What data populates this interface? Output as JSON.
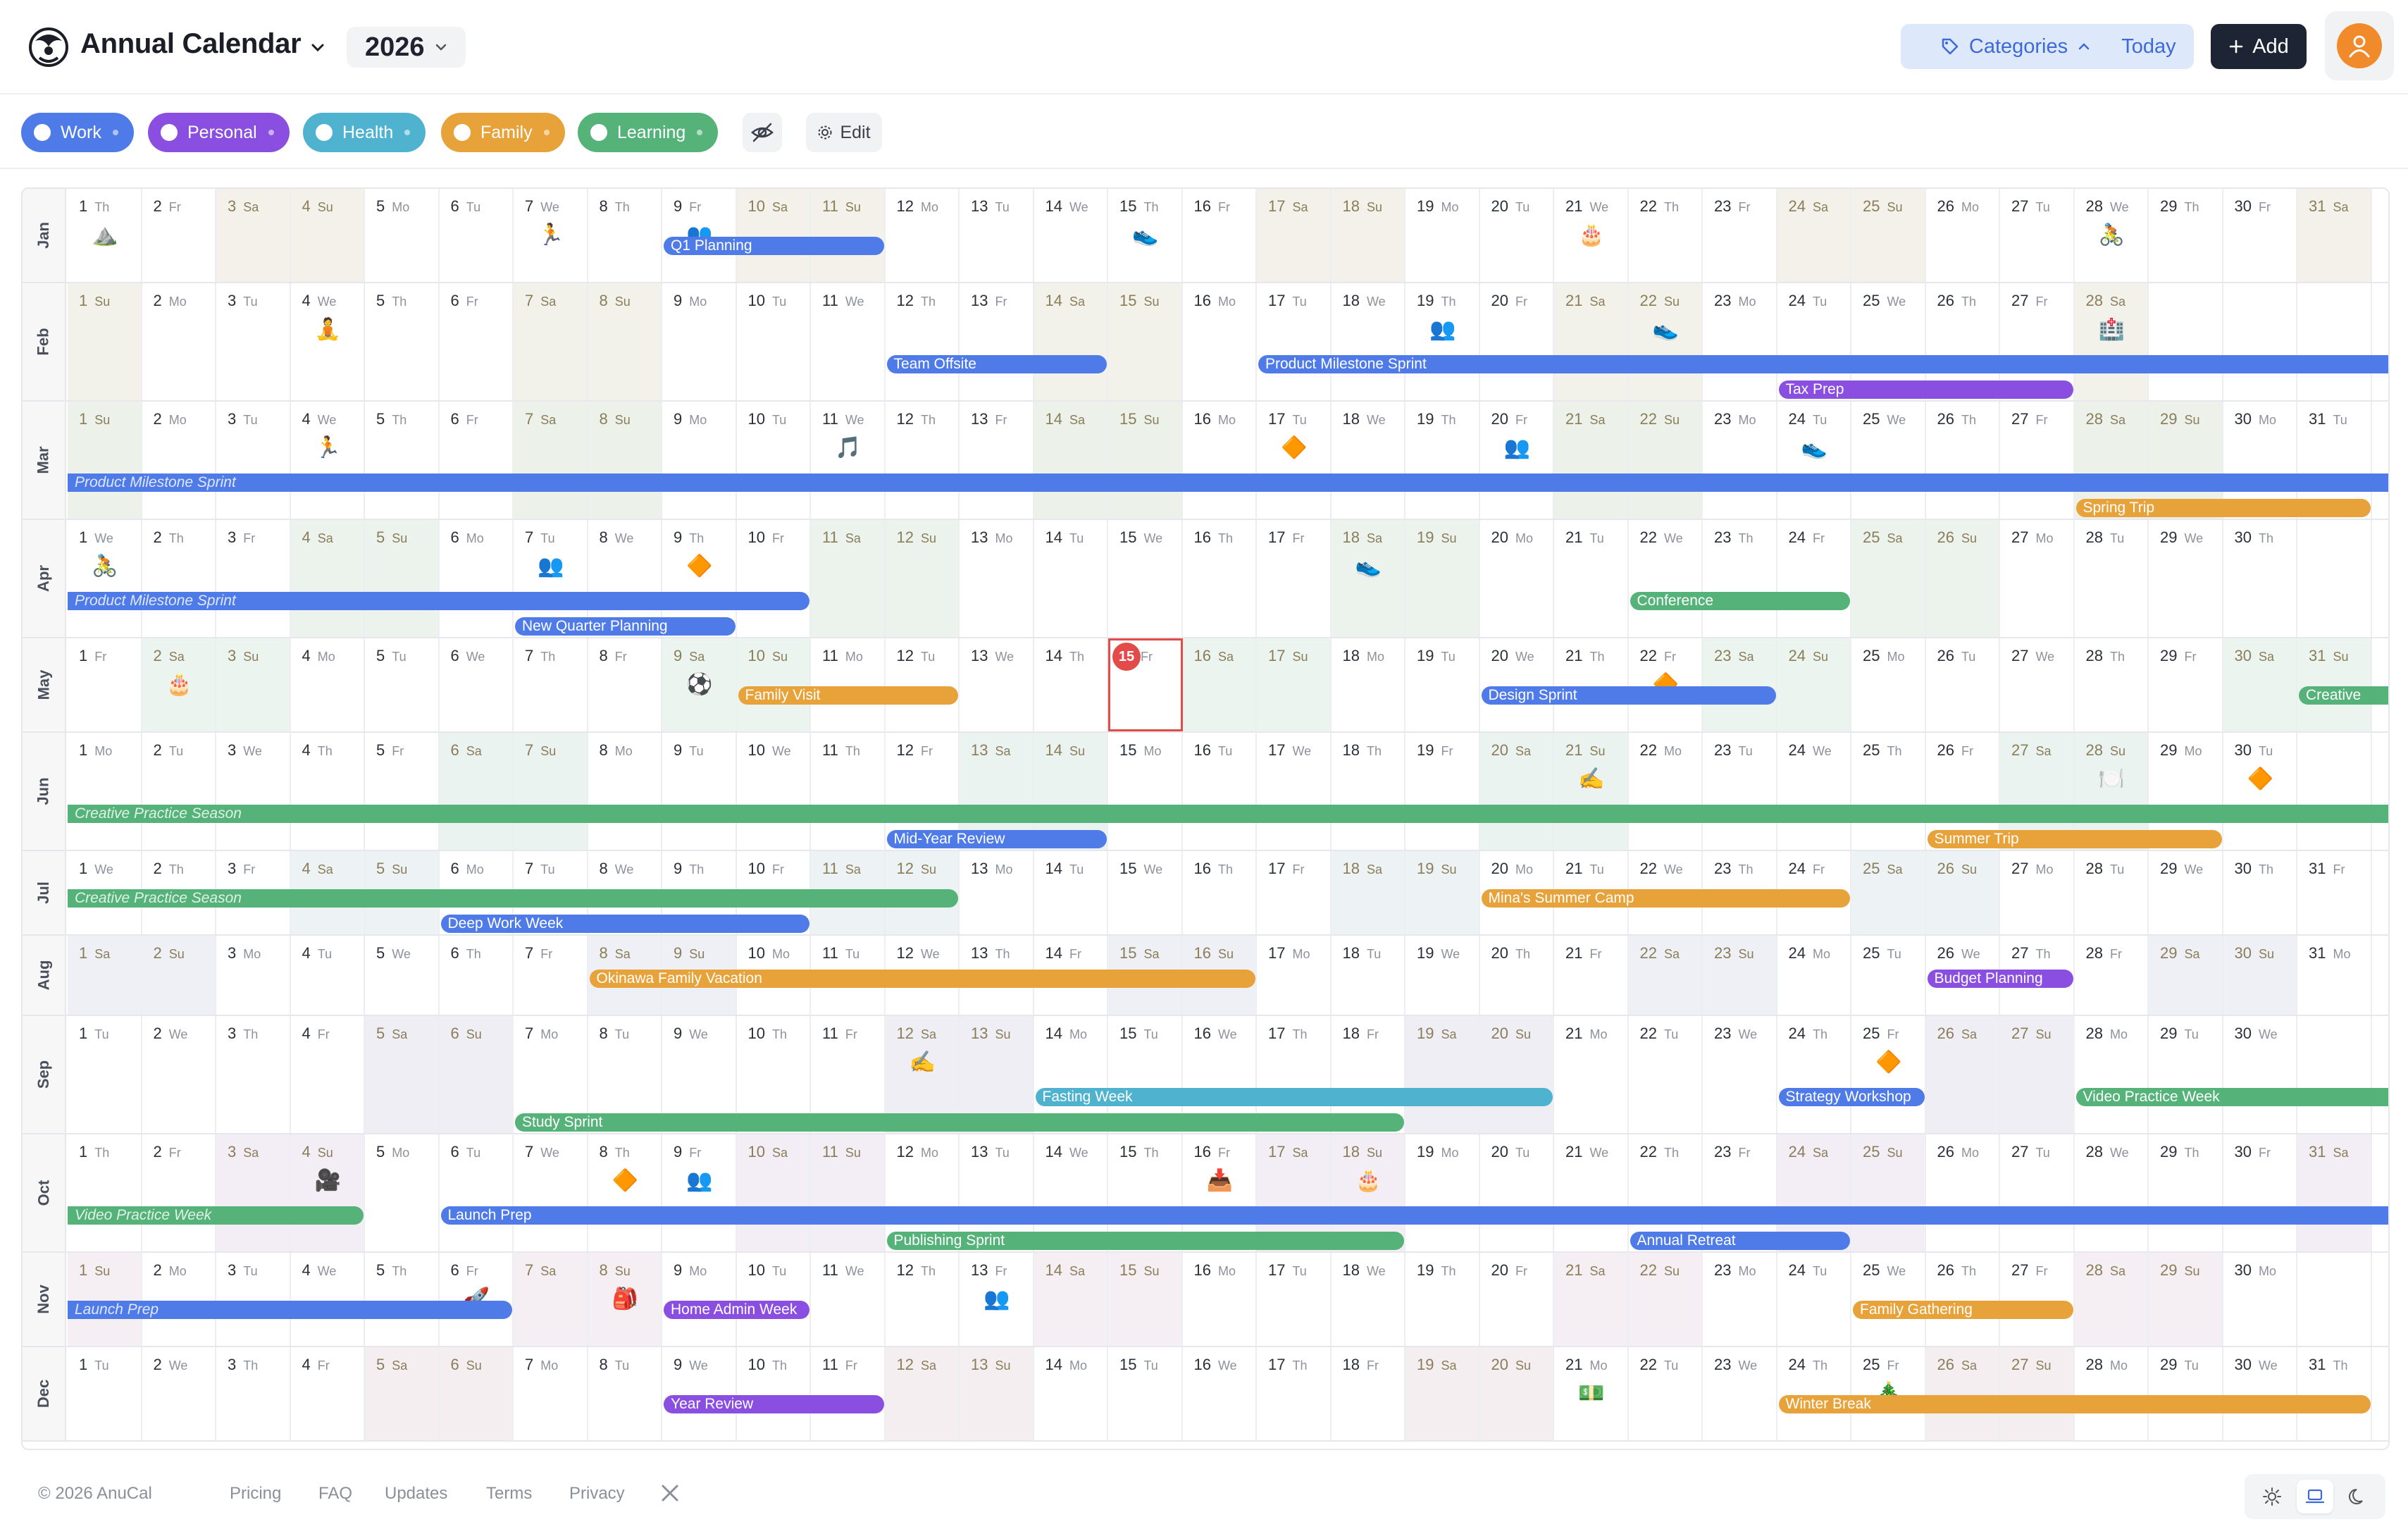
{
  "header": {
    "title": "Annual Calendar",
    "year": "2026",
    "categories_label": "Categories",
    "today_label": "Today",
    "add_label": "Add"
  },
  "filters": {
    "categories": [
      {
        "name": "Work",
        "color": "#4f7be8"
      },
      {
        "name": "Personal",
        "color": "#8a4fe0"
      },
      {
        "name": "Health",
        "color": "#4fb3d0"
      },
      {
        "name": "Family",
        "color": "#e8a23a"
      },
      {
        "name": "Learning",
        "color": "#55b37a"
      }
    ],
    "edit_label": "Edit"
  },
  "calendar": {
    "year": 2026,
    "today": {
      "month": 5,
      "day": 15
    },
    "months": [
      "Jan",
      "Feb",
      "Mar",
      "Apr",
      "May",
      "Jun",
      "Jul",
      "Aug",
      "Sep",
      "Oct",
      "Nov",
      "Dec"
    ],
    "weekdays": [
      "Su",
      "Mo",
      "Tu",
      "We",
      "Th",
      "Fr",
      "Sa"
    ],
    "month_shades": [
      "#f3f1ea",
      "#f2f2ea",
      "#ecf2ea",
      "#ebf3ec",
      "#ebf4ee",
      "#ebf3f1",
      "#edf2f4",
      "#eef0f5",
      "#f0eef5",
      "#f3eef5",
      "#f5eef3",
      "#f5eef1"
    ],
    "weekend_day_color": "#8a7d5a",
    "icons": [
      {
        "m": 1,
        "d": 1,
        "icon": "⛰️"
      },
      {
        "m": 1,
        "d": 7,
        "icon": "🏃"
      },
      {
        "m": 1,
        "d": 9,
        "icon": "👥"
      },
      {
        "m": 1,
        "d": 15,
        "icon": "👟"
      },
      {
        "m": 1,
        "d": 21,
        "icon": "🎂"
      },
      {
        "m": 1,
        "d": 28,
        "icon": "🚴"
      },
      {
        "m": 2,
        "d": 4,
        "icon": "🧘"
      },
      {
        "m": 2,
        "d": 19,
        "icon": "👥"
      },
      {
        "m": 2,
        "d": 22,
        "icon": "👟"
      },
      {
        "m": 2,
        "d": 28,
        "icon": "🏥"
      },
      {
        "m": 3,
        "d": 4,
        "icon": "🏃"
      },
      {
        "m": 3,
        "d": 11,
        "icon": "🎵"
      },
      {
        "m": 3,
        "d": 17,
        "icon": "🔶"
      },
      {
        "m": 3,
        "d": 20,
        "icon": "👥"
      },
      {
        "m": 3,
        "d": 24,
        "icon": "👟"
      },
      {
        "m": 4,
        "d": 1,
        "icon": "🚴"
      },
      {
        "m": 4,
        "d": 7,
        "icon": "👥"
      },
      {
        "m": 4,
        "d": 9,
        "icon": "🔶"
      },
      {
        "m": 4,
        "d": 18,
        "icon": "👟"
      },
      {
        "m": 5,
        "d": 2,
        "icon": "🎂"
      },
      {
        "m": 5,
        "d": 9,
        "icon": "⚽"
      },
      {
        "m": 5,
        "d": 22,
        "icon": "🔶"
      },
      {
        "m": 6,
        "d": 21,
        "icon": "✍️"
      },
      {
        "m": 6,
        "d": 28,
        "icon": "🍽️"
      },
      {
        "m": 6,
        "d": 30,
        "icon": "🔶"
      },
      {
        "m": 9,
        "d": 12,
        "icon": "✍️"
      },
      {
        "m": 9,
        "d": 25,
        "icon": "🔶"
      },
      {
        "m": 10,
        "d": 4,
        "icon": "🎥"
      },
      {
        "m": 10,
        "d": 8,
        "icon": "🔶"
      },
      {
        "m": 10,
        "d": 9,
        "icon": "👥"
      },
      {
        "m": 10,
        "d": 16,
        "icon": "📥"
      },
      {
        "m": 10,
        "d": 18,
        "icon": "🎂"
      },
      {
        "m": 11,
        "d": 6,
        "icon": "🚀"
      },
      {
        "m": 11,
        "d": 8,
        "icon": "🎒"
      },
      {
        "m": 11,
        "d": 13,
        "icon": "👥"
      },
      {
        "m": 12,
        "d": 21,
        "icon": "💵"
      },
      {
        "m": 12,
        "d": 25,
        "icon": "🎄"
      }
    ],
    "events": [
      {
        "m": 1,
        "start": 9,
        "end": 11,
        "lane": 0,
        "label": "Q1 Planning",
        "cat": "Work"
      },
      {
        "m": 2,
        "start": 12,
        "end": 14,
        "lane": 0,
        "label": "Team Offsite",
        "cat": "Work"
      },
      {
        "m": 2,
        "start": 17,
        "end": 28,
        "lane": 0,
        "label": "Product Milestone Sprint",
        "cat": "Work",
        "cont_next": true
      },
      {
        "m": 2,
        "start": 24,
        "end": 27,
        "lane": 1,
        "label": "Tax Prep",
        "cat": "Personal"
      },
      {
        "m": 3,
        "start": 1,
        "end": 31,
        "lane": 0,
        "label": "Product Milestone Sprint",
        "cat": "Work",
        "cont_prev": true,
        "cont_next": true
      },
      {
        "m": 3,
        "start": 28,
        "end": 31,
        "lane": 1,
        "label": "Spring Trip",
        "cat": "Family"
      },
      {
        "m": 4,
        "start": 1,
        "end": 10,
        "lane": 0,
        "label": "Product Milestone Sprint",
        "cat": "Work",
        "cont_prev": true
      },
      {
        "m": 4,
        "start": 22,
        "end": 24,
        "lane": 0,
        "label": "Conference",
        "cat": "Learning"
      },
      {
        "m": 4,
        "start": 7,
        "end": 9,
        "lane": 1,
        "label": "New Quarter Planning",
        "cat": "Work"
      },
      {
        "m": 5,
        "start": 10,
        "end": 12,
        "lane": 0,
        "label": "Family Visit",
        "cat": "Family"
      },
      {
        "m": 5,
        "start": 20,
        "end": 23,
        "lane": 0,
        "label": "Design Sprint",
        "cat": "Work"
      },
      {
        "m": 5,
        "start": 31,
        "end": 31,
        "lane": 0,
        "label": "Creative",
        "cat": "Learning",
        "cont_next": true
      },
      {
        "m": 6,
        "start": 1,
        "end": 30,
        "lane": 0,
        "label": "Creative Practice Season",
        "cat": "Learning",
        "cont_prev": true,
        "cont_next": true
      },
      {
        "m": 6,
        "start": 12,
        "end": 14,
        "lane": 1,
        "label": "Mid-Year Review",
        "cat": "Work"
      },
      {
        "m": 6,
        "start": 26,
        "end": 29,
        "lane": 1,
        "label": "Summer Trip",
        "cat": "Family"
      },
      {
        "m": 7,
        "start": 1,
        "end": 12,
        "lane": 0,
        "label": "Creative Practice Season",
        "cat": "Learning",
        "cont_prev": true
      },
      {
        "m": 7,
        "start": 20,
        "end": 24,
        "lane": 0,
        "label": "Mina's Summer Camp",
        "cat": "Family"
      },
      {
        "m": 7,
        "start": 6,
        "end": 10,
        "lane": 1,
        "label": "Deep Work Week",
        "cat": "Work"
      },
      {
        "m": 8,
        "start": 8,
        "end": 16,
        "lane": 0,
        "label": "Okinawa Family Vacation",
        "cat": "Family"
      },
      {
        "m": 8,
        "start": 26,
        "end": 27,
        "lane": 0,
        "label": "Budget Planning",
        "cat": "Personal"
      },
      {
        "m": 9,
        "start": 14,
        "end": 20,
        "lane": 0,
        "label": "Fasting Week",
        "cat": "Health"
      },
      {
        "m": 9,
        "start": 24,
        "end": 25,
        "lane": 0,
        "label": "Strategy Workshop",
        "cat": "Work"
      },
      {
        "m": 9,
        "start": 28,
        "end": 30,
        "lane": 0,
        "label": "Video Practice Week",
        "cat": "Learning",
        "cont_next": true
      },
      {
        "m": 9,
        "start": 7,
        "end": 18,
        "lane": 1,
        "label": "Study Sprint",
        "cat": "Learning"
      },
      {
        "m": 10,
        "start": 1,
        "end": 4,
        "lane": 0,
        "label": "Video Practice Week",
        "cat": "Learning",
        "cont_prev": true
      },
      {
        "m": 10,
        "start": 6,
        "end": 31,
        "lane": 0,
        "label": "Launch Prep",
        "cat": "Work",
        "cont_next": true
      },
      {
        "m": 10,
        "start": 12,
        "end": 18,
        "lane": 1,
        "label": "Publishing Sprint",
        "cat": "Learning"
      },
      {
        "m": 10,
        "start": 22,
        "end": 24,
        "lane": 1,
        "label": "Annual Retreat",
        "cat": "Work"
      },
      {
        "m": 11,
        "start": 1,
        "end": 6,
        "lane": 0,
        "label": "Launch Prep",
        "cat": "Work",
        "cont_prev": true
      },
      {
        "m": 11,
        "start": 9,
        "end": 10,
        "lane": 0,
        "label": "Home Admin Week",
        "cat": "Personal"
      },
      {
        "m": 11,
        "start": 25,
        "end": 27,
        "lane": 0,
        "label": "Family Gathering",
        "cat": "Family"
      },
      {
        "m": 12,
        "start": 9,
        "end": 11,
        "lane": 0,
        "label": "Year Review",
        "cat": "Personal"
      },
      {
        "m": 12,
        "start": 24,
        "end": 31,
        "lane": 0,
        "label": "Winter Break",
        "cat": "Family"
      }
    ]
  },
  "footer": {
    "copyright": "© 2026 AnuCal",
    "links": [
      "Pricing",
      "FAQ",
      "Updates",
      "Terms",
      "Privacy"
    ]
  }
}
